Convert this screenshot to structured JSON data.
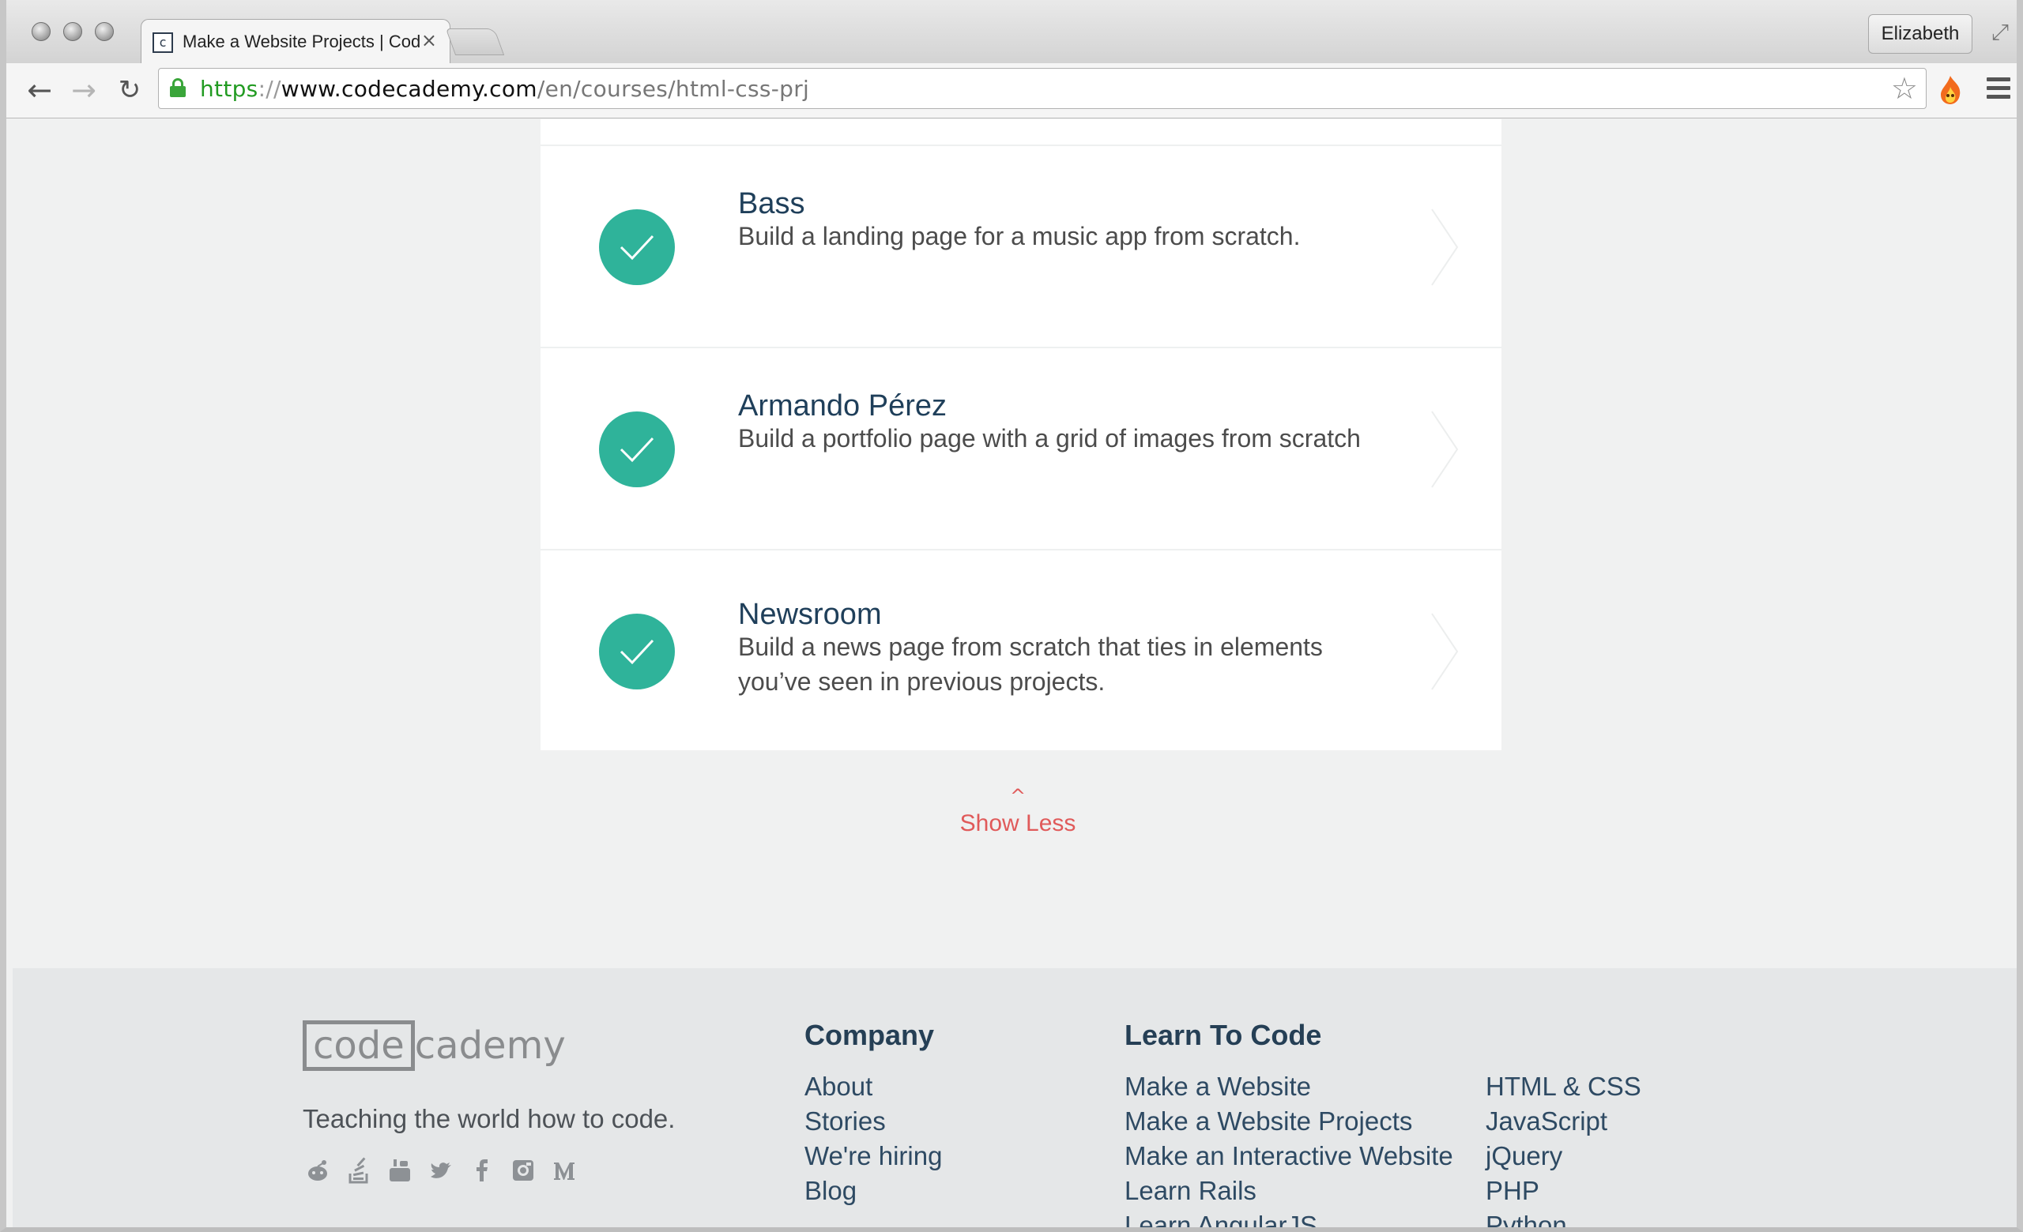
{
  "browser": {
    "tab_title": "Make a Website Projects | Codecademy",
    "tab_close": "×",
    "favicon_text": "c",
    "profile_name": "Elizabeth",
    "url_scheme": "https",
    "url_sep": "://",
    "url_host": "www.codecademy.com",
    "url_path": "/en/courses/html-css-prj"
  },
  "projects": [
    {
      "title": "Bass",
      "description": "Build a landing page for a music app from scratch."
    },
    {
      "title": "Armando Pérez",
      "description": "Build a portfolio page with a grid of images from scratch"
    },
    {
      "title": "Newsroom",
      "description": "Build a news page from scratch that ties in elements you’ve seen in previous projects."
    }
  ],
  "show_less": {
    "caret": "^",
    "label": "Show Less"
  },
  "footer": {
    "logo_box": "code",
    "logo_rest": "cademy",
    "tagline": "Teaching the world how to code.",
    "social": [
      "reddit-icon",
      "stackoverflow-icon",
      "youtube-icon",
      "twitter-icon",
      "facebook-icon",
      "instagram-icon",
      "medium-icon"
    ],
    "company": {
      "heading": "Company",
      "links": [
        "About",
        "Stories",
        "We're hiring",
        "Blog"
      ]
    },
    "learn": {
      "heading": "Learn To Code",
      "links_left": [
        "Make a Website",
        "Make a Website Projects",
        "Make an Interactive Website",
        "Learn Rails",
        "Learn AngularJS"
      ],
      "links_right": [
        "HTML & CSS",
        "JavaScript",
        "jQuery",
        "PHP",
        "Python"
      ]
    }
  },
  "colors": {
    "accent_teal": "#2fb39a",
    "accent_red": "#e05a5a",
    "title_navy": "#1f3f5a"
  }
}
